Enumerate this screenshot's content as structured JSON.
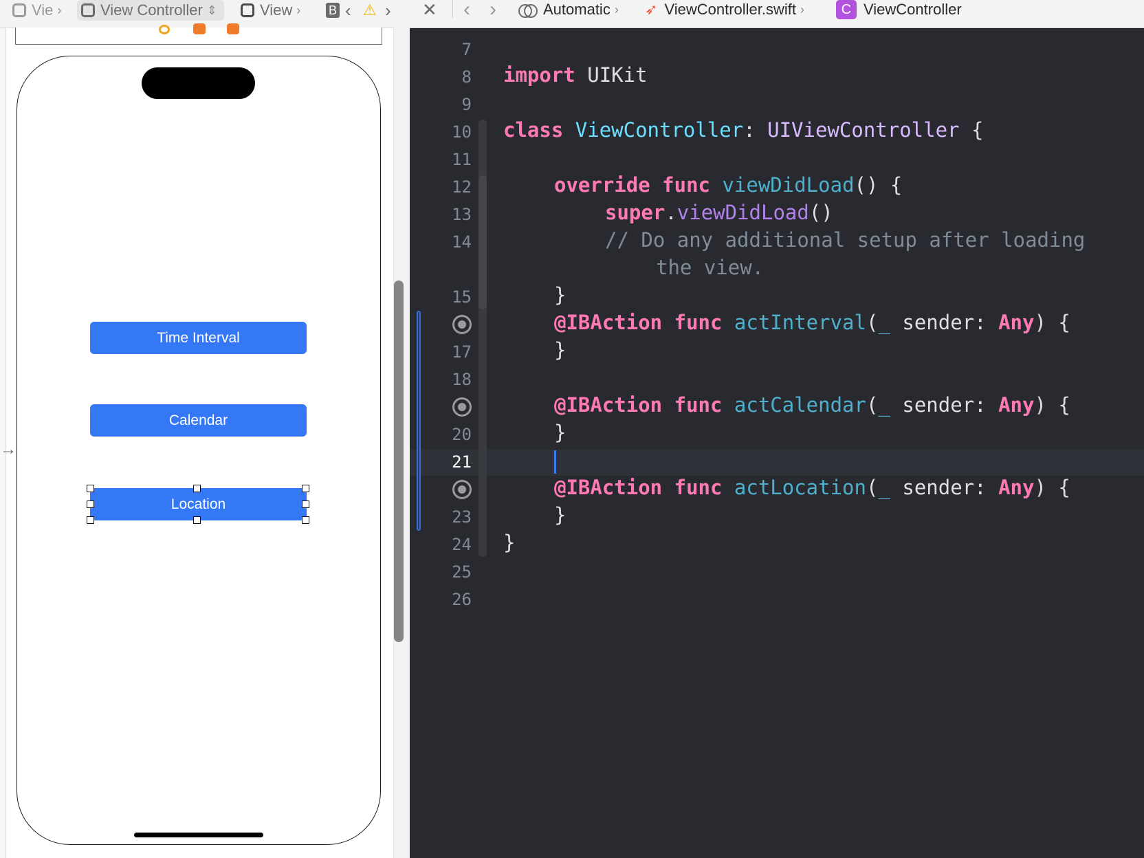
{
  "left_tabs": {
    "tab1": "Vie",
    "tab2": "View Controller",
    "tab3": "View",
    "tab4": "B"
  },
  "storyboard": {
    "buttons": [
      {
        "label": "Time Interval"
      },
      {
        "label": "Calendar"
      },
      {
        "label": "Location"
      }
    ],
    "selected_button": "Location"
  },
  "jump_bar": {
    "automatic": "Automatic",
    "file": "ViewController.swift",
    "class_badge": "C",
    "symbol": "ViewController"
  },
  "editor": {
    "current_line": "21",
    "line_numbers": {
      "l7": "7",
      "l8": "8",
      "l9": "9",
      "l10": "10",
      "l11": "11",
      "l12": "12",
      "l13": "13",
      "l14": "14",
      "l15": "15",
      "l17": "17",
      "l18": "18",
      "l20": "20",
      "l21": "21",
      "l23": "23",
      "l24": "24",
      "l25": "25",
      "l26": "26"
    },
    "code": {
      "import_kw": "import",
      "import_mod": "UIKit",
      "class_kw": "class",
      "class_name": "ViewController",
      "class_super": "UIViewController",
      "override_kw": "override",
      "func_kw": "func",
      "viewDidLoad": "viewDidLoad",
      "super_kw": "super",
      "comment_1": "// Do any additional setup after loading",
      "comment_2": "the view.",
      "ibaction": "@IBAction",
      "act1": "actInterval",
      "act2": "actCalendar",
      "act3": "actLocation",
      "underscore": "_",
      "sender": "sender:",
      "any": "Any"
    }
  },
  "colors": {
    "keyword": "#ff7ab2",
    "type": "#dabaff",
    "declaration": "#6bdfff",
    "function": "#4eb0cc",
    "comment": "#7f8c98",
    "ios_button": "#3478f6"
  }
}
